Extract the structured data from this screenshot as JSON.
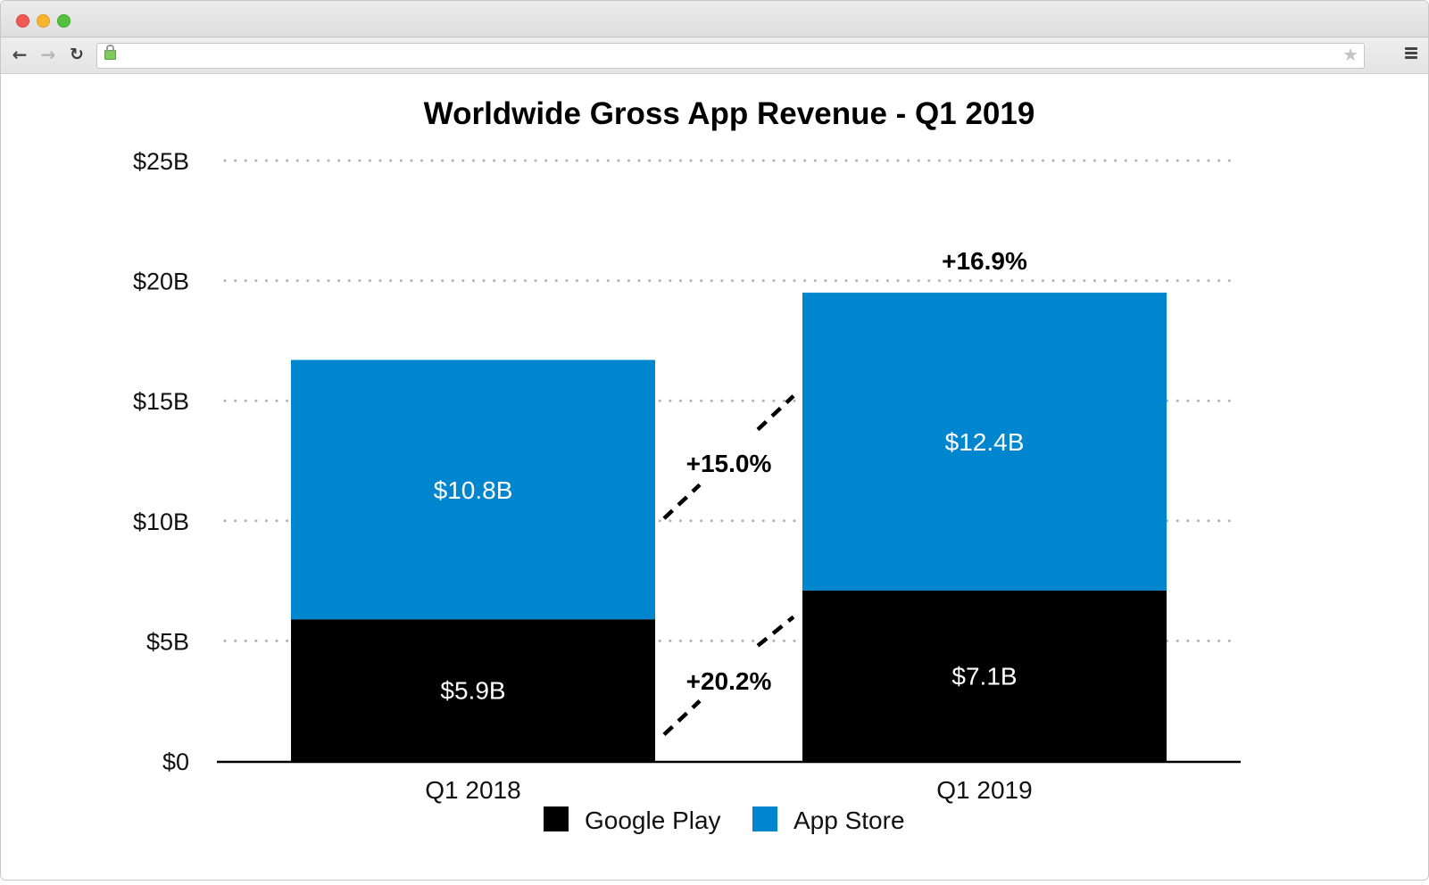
{
  "browser": {
    "url": "",
    "back_icon": "arrow-left-icon",
    "forward_icon": "arrow-right-icon",
    "reload_icon": "reload-icon",
    "lock_icon": "lock-icon",
    "bookmark_icon": "star-icon",
    "menu_icon": "hamburger-menu-icon"
  },
  "colors": {
    "google_play": "#000000",
    "app_store": "#0085CF",
    "grid": "#b3b3b3",
    "axis": "#000000"
  },
  "chart_data": {
    "type": "bar",
    "stacked": true,
    "title": "Worldwide Gross App Revenue - Q1 2019",
    "xlabel": "",
    "ylabel": "",
    "categories": [
      "Q1 2018",
      "Q1 2019"
    ],
    "series": [
      {
        "name": "Google Play",
        "values": [
          5.9,
          7.1
        ],
        "labels": [
          "$5.9B",
          "$7.1B"
        ],
        "color": "#000000"
      },
      {
        "name": "App Store",
        "values": [
          10.8,
          12.4
        ],
        "labels": [
          "$10.8B",
          "$12.4B"
        ],
        "color": "#0085CF"
      }
    ],
    "ylim": [
      0,
      25
    ],
    "yticks": [
      0,
      5,
      10,
      15,
      20,
      25
    ],
    "ytick_labels": [
      "$0",
      "$5B",
      "$10B",
      "$15B",
      "$20B",
      "$25B"
    ],
    "grid": "dotted horizontal",
    "legend": {
      "position": "bottom-center",
      "entries": [
        "Google Play",
        "App Store"
      ]
    },
    "annotations": [
      {
        "text": "+16.9%",
        "meaning": "total growth",
        "target": "Q1 2019 total"
      },
      {
        "text": "+15.0%",
        "meaning": "App Store growth",
        "target": "between bars, App Store segment"
      },
      {
        "text": "+20.2%",
        "meaning": "Google Play growth",
        "target": "between bars, Google Play segment"
      }
    ]
  }
}
